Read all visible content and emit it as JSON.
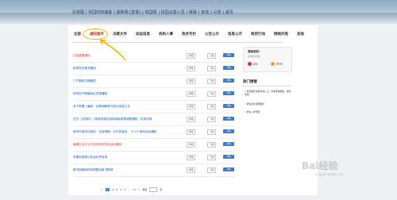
{
  "topnav": [
    "伦敦图",
    "| 校园时刻播客",
    "| 最新网 [登录]",
    "| 校园网",
    "| 校园设置人员",
    "| 链接",
    "| 其他",
    "| 公告",
    "| 首页"
  ],
  "mainnav": [
    "全部",
    "通知案件",
    "决策文件",
    "动态信息",
    "机构人事",
    "政务专栏",
    "公告公示",
    "信息公开",
    "政府行动",
    "网络问卷",
    "其他"
  ],
  "active_nav": 1,
  "rows": [
    {
      "title": "红色重要通知",
      "red": true,
      "b1": "查看",
      "b2": "下载",
      "b3": "详情"
    },
    {
      "title": "秋季学生教学通知",
      "red": false,
      "b1": "查看",
      "b2": "下载",
      "b3": "详情"
    },
    {
      "title": "门户更新日期通知",
      "red": false,
      "b1": "查看",
      "b2": "下载",
      "b3": "详情"
    },
    {
      "title": "机构电子邮箱地址变更通知",
      "red": false,
      "b1": "查看",
      "b2": "下载",
      "b3": "详情"
    },
    {
      "title": "电子签署 | 最新：互联网教育开放日信息汇总",
      "red": false,
      "b1": "查看",
      "b2": "下载",
      "b3": "详情"
    },
    {
      "title": "社员（全机构）| 新版学费标准和减免政策调整通知，作息时间",
      "red": false,
      "b1": "查看",
      "b2": "下载",
      "b3": "详情"
    },
    {
      "title": "城市环境变化报告：天色晴朗，空气质量优，“3·15”宣传活动通知",
      "red": false,
      "b1": "查看",
      "b2": "下载",
      "b3": "详情"
    },
    {
      "title": "暑期生活中心开放时间安排及活动通知",
      "red": true,
      "b1": "查看",
      "b2": "下载",
      "b3": "详情"
    },
    {
      "title": "学期末成绩公布及补考安排",
      "red": false,
      "b1": "查看",
      "b2": "下载",
      "b3": "详情"
    },
    {
      "title": "图书馆借阅时间调整及新书推荐",
      "red": false,
      "b1": "查看",
      "b2": "下载",
      "b3": "详情"
    }
  ],
  "sidebox": {
    "title": "搜索类别：",
    "sub": "选择检索范围",
    "opt1": "最新",
    "opt2": "按时间"
  },
  "hot": {
    "title": "热门搜索",
    "items": [
      "• 学生服务系统查询入口，查看学期成绩、课表安排",
      "• 学生宿舍管理规定",
      "• 学生入学须知"
    ]
  },
  "pager": [
    "<",
    "1",
    "2",
    "3",
    "4",
    "5",
    "...",
    "13",
    ">",
    "跳至",
    "页"
  ],
  "watermark": "Bai经验",
  "watermark_sub": "jingyan.baidu.com",
  "colors": {
    "link": "#1a55b7",
    "link_red": "#d9342b",
    "highlight": "#f2b600",
    "primary": "#3d78d8"
  }
}
